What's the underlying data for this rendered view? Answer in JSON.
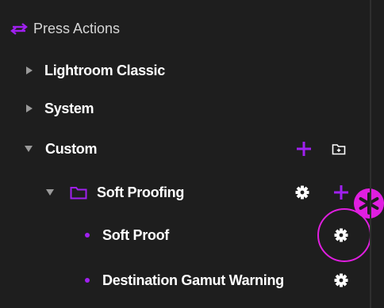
{
  "header": {
    "title": "Press Actions",
    "icon": "swap-arrows-icon"
  },
  "tree": {
    "items": [
      {
        "label": "Lightroom Classic",
        "expanded": false
      },
      {
        "label": "System",
        "expanded": false
      },
      {
        "label": "Custom",
        "expanded": true
      },
      {
        "label": "Soft Proofing",
        "expanded": true,
        "icon": "folder-icon"
      },
      {
        "label": "Soft Proof",
        "icon": "bullet-dot"
      },
      {
        "label": "Destination Gamut Warning",
        "icon": "bullet-dot"
      }
    ]
  },
  "annotation": {
    "marker": "*",
    "note": "highlight-circle"
  },
  "colors": {
    "background": "#1e1e1e",
    "accent": "#a020f0",
    "annotation": "#e01ee0",
    "text": "#ffffff",
    "muted": "#9a9a9a"
  }
}
